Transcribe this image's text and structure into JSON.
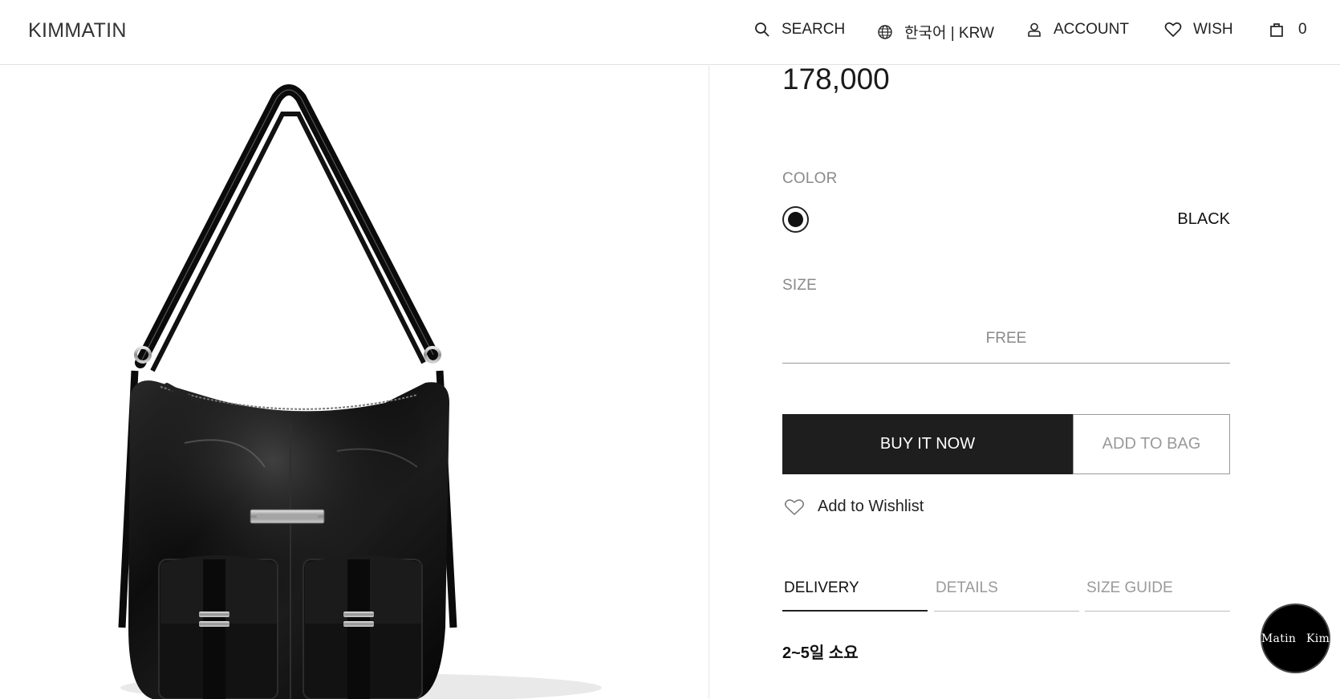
{
  "header": {
    "logo": "KIMMATIN",
    "search_label": "SEARCH",
    "language_label": "한국어 | KRW",
    "account_label": "ACCOUNT",
    "wish_label": "WISH",
    "cart_count": "0"
  },
  "product": {
    "price": "178,000",
    "color_label": "COLOR",
    "selected_color": "BLACK",
    "color_swatch": "#111111",
    "size_label": "SIZE",
    "size_option": "FREE",
    "buy_now_label": "BUY IT NOW",
    "add_to_bag_label": "ADD TO BAG",
    "add_to_wishlist_label": "Add to Wishlist"
  },
  "tabs": [
    {
      "label": "DELIVERY",
      "active": true
    },
    {
      "label": "DETAILS",
      "active": false
    },
    {
      "label": "SIZE GUIDE",
      "active": false
    }
  ],
  "delivery": {
    "text": "2~5일 소요"
  },
  "chat_widget": {
    "label": "Matin Kim"
  },
  "icons": {
    "search": "search-icon",
    "language": "globe-icon",
    "account": "user-icon",
    "wish": "heart-icon",
    "cart": "shopping-bag-icon",
    "wishlist": "heart-outline-icon"
  }
}
